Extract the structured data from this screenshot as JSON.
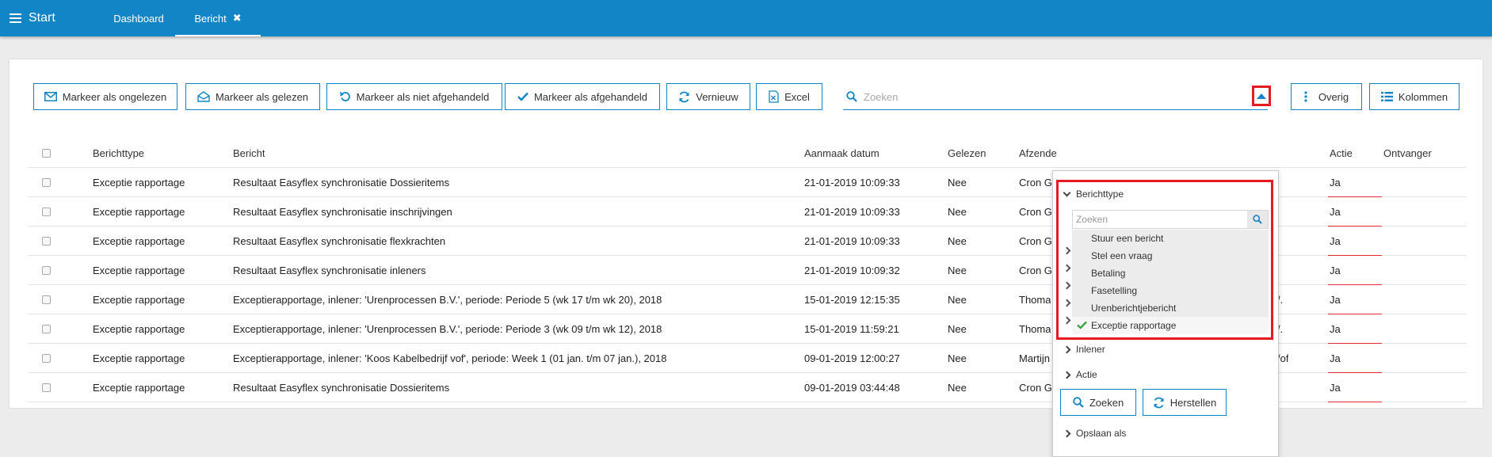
{
  "topbar": {
    "start_label": "Start",
    "tabs": [
      {
        "label": "Dashboard"
      },
      {
        "label": "Bericht",
        "close": "✖"
      }
    ]
  },
  "toolbar": {
    "buttons": [
      {
        "label": "Markeer als ongelezen",
        "icon": "envelope-icon"
      },
      {
        "label": "Markeer als gelezen",
        "icon": "envelope-open-icon"
      },
      {
        "label": "Markeer als niet afgehandeld",
        "icon": "undo-icon"
      },
      {
        "label": "Markeer als afgehandeld",
        "icon": "check-icon"
      },
      {
        "label": "Vernieuw",
        "icon": "refresh-icon"
      },
      {
        "label": "Excel",
        "icon": "excel-file-icon"
      },
      {
        "label": "Overig",
        "icon": "vertical-ellipsis-icon"
      },
      {
        "label": "Kolommen",
        "icon": "list-icon"
      }
    ],
    "search_placeholder": "Zoeken"
  },
  "table": {
    "headers": [
      "Berichttype",
      "Bericht",
      "Aanmaak datum",
      "Gelezen",
      "Afzender",
      "Actie",
      "Ontvanger"
    ],
    "rows": [
      {
        "type": "Exceptie rapportage",
        "bericht": "Resultaat Easyflex synchronisatie Dossieritems",
        "datum": "21-01-2019 10:09:33",
        "gelezen": "Nee",
        "afzender": "Cron G",
        "extra": "",
        "actie": "Ja"
      },
      {
        "type": "Exceptie rapportage",
        "bericht": "Resultaat Easyflex synchronisatie inschrijvingen",
        "datum": "21-01-2019 10:09:33",
        "gelezen": "Nee",
        "afzender": "Cron G",
        "extra": "",
        "actie": "Ja"
      },
      {
        "type": "Exceptie rapportage",
        "bericht": "Resultaat Easyflex synchronisatie flexkrachten",
        "datum": "21-01-2019 10:09:33",
        "gelezen": "Nee",
        "afzender": "Cron G",
        "extra": "",
        "actie": "Ja"
      },
      {
        "type": "Exceptie rapportage",
        "bericht": "Resultaat Easyflex synchronisatie inleners",
        "datum": "21-01-2019 10:09:32",
        "gelezen": "Nee",
        "afzender": "Cron G",
        "extra": "",
        "actie": "Ja"
      },
      {
        "type": "Exceptie rapportage",
        "bericht": "Exceptierapportage, inlener: 'Urenprocessen B.V.', periode: Periode 5 (wk 17 t/m wk 20), 2018",
        "datum": "15-01-2019 12:15:35",
        "gelezen": "Nee",
        "afzender": "Thoma",
        "extra": "/.",
        "actie": "Ja"
      },
      {
        "type": "Exceptie rapportage",
        "bericht": "Exceptierapportage, inlener: 'Urenprocessen B.V.', periode: Periode 3 (wk 09 t/m wk 12), 2018",
        "datum": "15-01-2019 11:59:21",
        "gelezen": "Nee",
        "afzender": "Thoma",
        "extra": "/.",
        "actie": "Ja"
      },
      {
        "type": "Exceptie rapportage",
        "bericht": "Exceptierapportage, inlener: 'Koos Kabelbedrijf vof', periode: Week 1 (01 jan. t/m 07 jan.), 2018",
        "datum": "09-01-2019 12:00:27",
        "gelezen": "Nee",
        "afzender": "Martijn",
        "extra": "/of",
        "actie": "Ja"
      },
      {
        "type": "Exceptie rapportage",
        "bericht": "Resultaat Easyflex synchronisatie Dossieritems",
        "datum": "09-01-2019 03:44:48",
        "gelezen": "Nee",
        "afzender": "Cron G",
        "extra": "",
        "actie": "Ja"
      }
    ]
  },
  "filter": {
    "section_label": "Berichttype",
    "search_placeholder": "Zoeken",
    "options": [
      {
        "label": "Stuur een bericht",
        "selected": false
      },
      {
        "label": "Stel een vraag",
        "selected": false
      },
      {
        "label": "Betaling",
        "selected": false
      },
      {
        "label": "Fasetelling",
        "selected": false
      },
      {
        "label": "Urenberichtjebericht",
        "selected": false
      },
      {
        "label": "Exceptie rapportage",
        "selected": true
      }
    ],
    "inlener_label": "Inlener",
    "actie_label": "Actie",
    "zoeken_button": "Zoeken",
    "herstellen_button": "Herstellen",
    "opslaan_label": "Opslaan als"
  },
  "colors": {
    "accent": "#1285c6",
    "highlight": "#e51b24",
    "check": "#3aa540"
  }
}
